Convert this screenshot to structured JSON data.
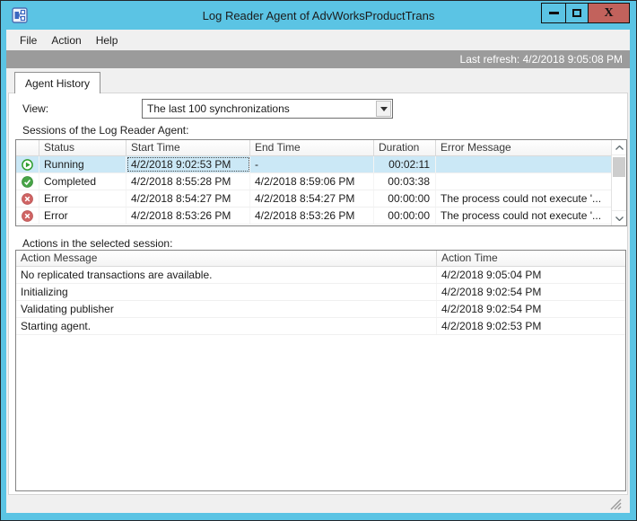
{
  "window": {
    "title": "Log Reader Agent of AdvWorksProductTrans",
    "app_icon": "replication-monitor-icon",
    "close_glyph": "X"
  },
  "menu": {
    "items": [
      "File",
      "Action",
      "Help"
    ]
  },
  "refreshbar": {
    "last_refresh": "Last refresh: 4/2/2018 9:05:08 PM"
  },
  "tabs": [
    {
      "label": "Agent History"
    }
  ],
  "view": {
    "label": "View:",
    "selected": "The last 100 synchronizations"
  },
  "sessions": {
    "label": "Sessions of the Log Reader Agent:",
    "columns": [
      "",
      "Status",
      "Start Time",
      "End Time",
      "Duration",
      "Error Message"
    ],
    "rows": [
      {
        "icon": "running-icon",
        "status": "Running",
        "start": "4/2/2018 9:02:53 PM",
        "end": "-",
        "duration": "00:02:11",
        "error": "",
        "selected": true
      },
      {
        "icon": "completed-icon",
        "status": "Completed",
        "start": "4/2/2018 8:55:28 PM",
        "end": "4/2/2018 8:59:06 PM",
        "duration": "00:03:38",
        "error": "",
        "selected": false
      },
      {
        "icon": "error-icon",
        "status": "Error",
        "start": "4/2/2018 8:54:27 PM",
        "end": "4/2/2018 8:54:27 PM",
        "duration": "00:00:00",
        "error": "The process could not execute '...",
        "selected": false
      },
      {
        "icon": "error-icon",
        "status": "Error",
        "start": "4/2/2018 8:53:26 PM",
        "end": "4/2/2018 8:53:26 PM",
        "duration": "00:00:00",
        "error": "The process could not execute '...",
        "selected": false
      }
    ]
  },
  "actions": {
    "label": "Actions in the selected session:",
    "columns": [
      "Action Message",
      "Action Time"
    ],
    "rows": [
      {
        "message": "No replicated transactions are available.",
        "time": "4/2/2018 9:05:04 PM"
      },
      {
        "message": "Initializing",
        "time": "4/2/2018 9:02:54 PM"
      },
      {
        "message": "Validating publisher",
        "time": "4/2/2018 9:02:54 PM"
      },
      {
        "message": "Starting agent.",
        "time": "4/2/2018 9:02:53 PM"
      }
    ]
  },
  "colors": {
    "titlebar": "#5bc4e4",
    "close_button": "#c2625c",
    "refresh_bar": "#9b9b9b",
    "selected_row": "#cbe8f6",
    "status_running": "#2f9e2f",
    "status_completed": "#47a447",
    "status_error": "#cf6464"
  }
}
